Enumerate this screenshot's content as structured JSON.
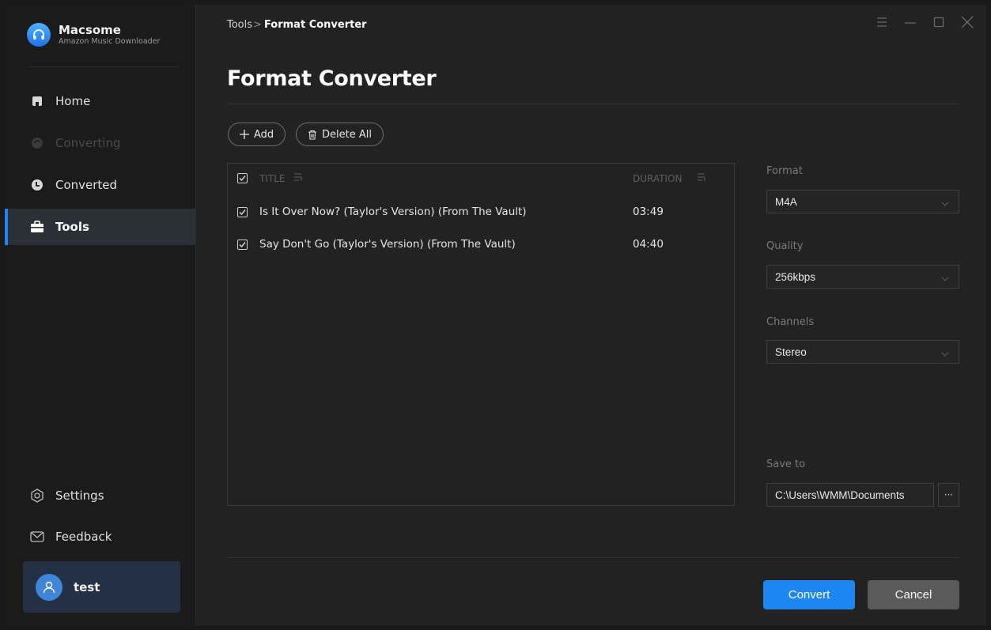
{
  "app": {
    "name": "Macsome",
    "subtitle": "Amazon Music Downloader"
  },
  "sidebar": {
    "items": [
      {
        "label": "Home",
        "icon": "home-icon",
        "state": "normal"
      },
      {
        "label": "Converting",
        "icon": "converting-icon",
        "state": "disabled"
      },
      {
        "label": "Converted",
        "icon": "clock-icon",
        "state": "normal"
      },
      {
        "label": "Tools",
        "icon": "toolbox-icon",
        "state": "active"
      }
    ],
    "bottom_items": [
      {
        "label": "Settings",
        "icon": "settings-icon"
      },
      {
        "label": "Feedback",
        "icon": "mail-icon"
      }
    ],
    "user": {
      "name": "test"
    }
  },
  "header": {
    "breadcrumb_parent": "Tools",
    "breadcrumb_sep": ">",
    "breadcrumb_current": "Format Converter"
  },
  "page": {
    "title": "Format Converter"
  },
  "toolbar": {
    "add_label": "Add",
    "delete_all_label": "Delete All"
  },
  "table": {
    "columns": {
      "title": "TITLE",
      "duration": "DURATION"
    },
    "rows": [
      {
        "title": "Is It Over Now? (Taylor's Version) (From The Vault)",
        "duration": "03:49",
        "checked": true
      },
      {
        "title": "Say Don't Go (Taylor's Version) (From The Vault)",
        "duration": "04:40",
        "checked": true
      }
    ]
  },
  "settings": {
    "format": {
      "label": "Format",
      "value": "M4A"
    },
    "quality": {
      "label": "Quality",
      "value": "256kbps"
    },
    "channels": {
      "label": "Channels",
      "value": "Stereo"
    },
    "save_to": {
      "label": "Save to",
      "value": "C:\\Users\\WMM\\Documents",
      "browse": "···"
    }
  },
  "actions": {
    "convert_label": "Convert",
    "cancel_label": "Cancel"
  },
  "colors": {
    "accent": "#1d86f0",
    "background": "#222222",
    "sidebar": "#1b1b1b"
  }
}
